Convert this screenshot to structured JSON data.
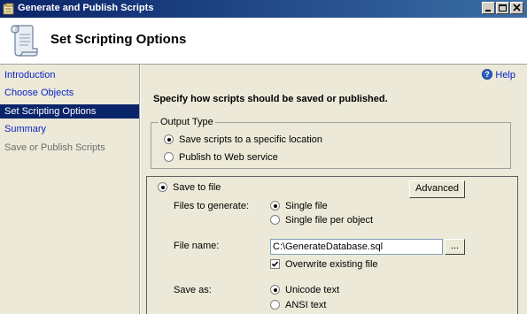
{
  "window": {
    "title": "Generate and Publish Scripts"
  },
  "header": {
    "title": "Set Scripting Options",
    "icon": "scroll-icon"
  },
  "sidebar": {
    "items": [
      {
        "label": "Introduction",
        "state": "link"
      },
      {
        "label": "Choose Objects",
        "state": "link"
      },
      {
        "label": "Set Scripting Options",
        "state": "active"
      },
      {
        "label": "Summary",
        "state": "link"
      },
      {
        "label": "Save or Publish Scripts",
        "state": "disabled"
      }
    ]
  },
  "main": {
    "help_label": "Help",
    "instruction": "Specify how scripts should be saved or published.",
    "output_type": {
      "legend": "Output Type",
      "options": [
        {
          "label": "Save scripts to a specific location",
          "selected": true
        },
        {
          "label": "Publish to Web service",
          "selected": false
        }
      ]
    },
    "save_to_file": {
      "label": "Save to file",
      "selected": true,
      "advanced_label": "Advanced",
      "files_to_generate": {
        "label": "Files to generate:",
        "options": [
          {
            "label": "Single file",
            "selected": true
          },
          {
            "label": "Single file per object",
            "selected": false
          }
        ]
      },
      "file_name": {
        "label": "File name:",
        "value": "C:\\GenerateDatabase.sql",
        "browse_label": "..."
      },
      "overwrite": {
        "label": "Overwrite existing file",
        "checked": true
      },
      "save_as": {
        "label": "Save as:",
        "options": [
          {
            "label": "Unicode text",
            "selected": true
          },
          {
            "label": "ANSI text",
            "selected": false
          }
        ]
      }
    }
  },
  "colors": {
    "accent": "#0a246a",
    "link": "#0a24c8"
  }
}
